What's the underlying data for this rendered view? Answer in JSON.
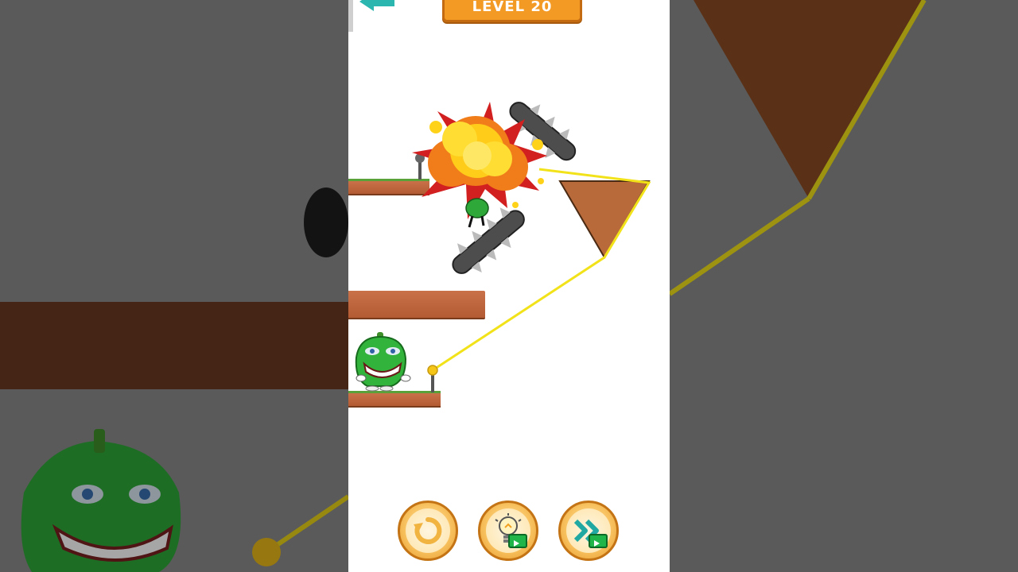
{
  "level": {
    "label": "LEVEL 20"
  },
  "controls": {
    "restart": {
      "icon": "restart-icon"
    },
    "hint": {
      "icon": "lightbulb-icon",
      "badge": "video-ad-icon"
    },
    "skip": {
      "icon": "fast-forward-icon",
      "badge": "video-ad-icon"
    }
  },
  "scene": {
    "characters": [
      "green-pepper-player",
      "green-pepper-enemy-exploding"
    ],
    "hazards": [
      "spiked-saw-bar-upper",
      "spiked-saw-bar-lower",
      "explosion"
    ],
    "rope_color": "#f2e21a",
    "wood_color": "#b35c34",
    "grass_color": "#5aa13a"
  },
  "colors": {
    "banner": "#f39a25",
    "button_gold": "#f8c260",
    "accent_teal": "#2bb6b0",
    "ad_green": "#1fb548"
  }
}
